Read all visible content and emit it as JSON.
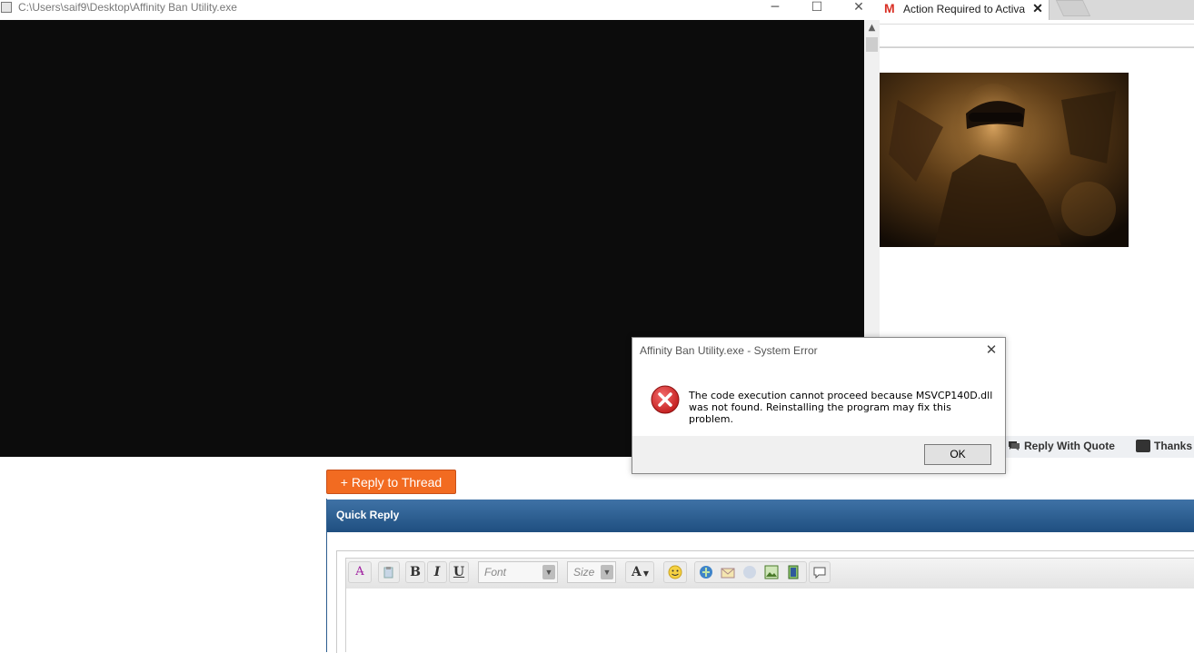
{
  "console_window": {
    "title": "C:\\Users\\saif9\\Desktop\\Affinity Ban Utility.exe",
    "minimize_glyph": "─",
    "maximize_glyph": "☐",
    "close_glyph": "✕",
    "scroll_up_glyph": "▲"
  },
  "browser": {
    "tab_icon_glyph": "M",
    "tab_title": "Action Required to Activa",
    "tab_close_glyph": "✕"
  },
  "forum": {
    "reply_with_quote": "Reply With Quote",
    "thanks": "Thanks",
    "reply_to_thread": "+ Reply to Thread",
    "quick_reply_title": "Quick Reply",
    "editor": {
      "bold": "B",
      "italic": "I",
      "underline": "U",
      "font_placeholder": "Font",
      "size_placeholder": "Size",
      "text_color": "A",
      "dropdown_glyph": "▼"
    }
  },
  "error_dialog": {
    "title": "Affinity Ban Utility.exe - System Error",
    "message_line1": "The code execution cannot proceed because MSVCP140D.dll",
    "message_line2": "was not found. Reinstalling the program may fix this problem.",
    "ok_label": "OK",
    "close_glyph": "✕"
  },
  "colors": {
    "console_bg": "#0c0c0c",
    "reply_button": "#f26b21",
    "quick_reply_header": "#2c5d8f",
    "error_red": "#d32f2f"
  },
  "icons": [
    "gmail-icon",
    "error-icon",
    "quote-icon",
    "thanks-icon",
    "close-icon",
    "minimize-icon",
    "maximize-icon",
    "smiley-icon",
    "link-icon",
    "email-icon",
    "image-icon",
    "video-icon",
    "comment-icon"
  ]
}
